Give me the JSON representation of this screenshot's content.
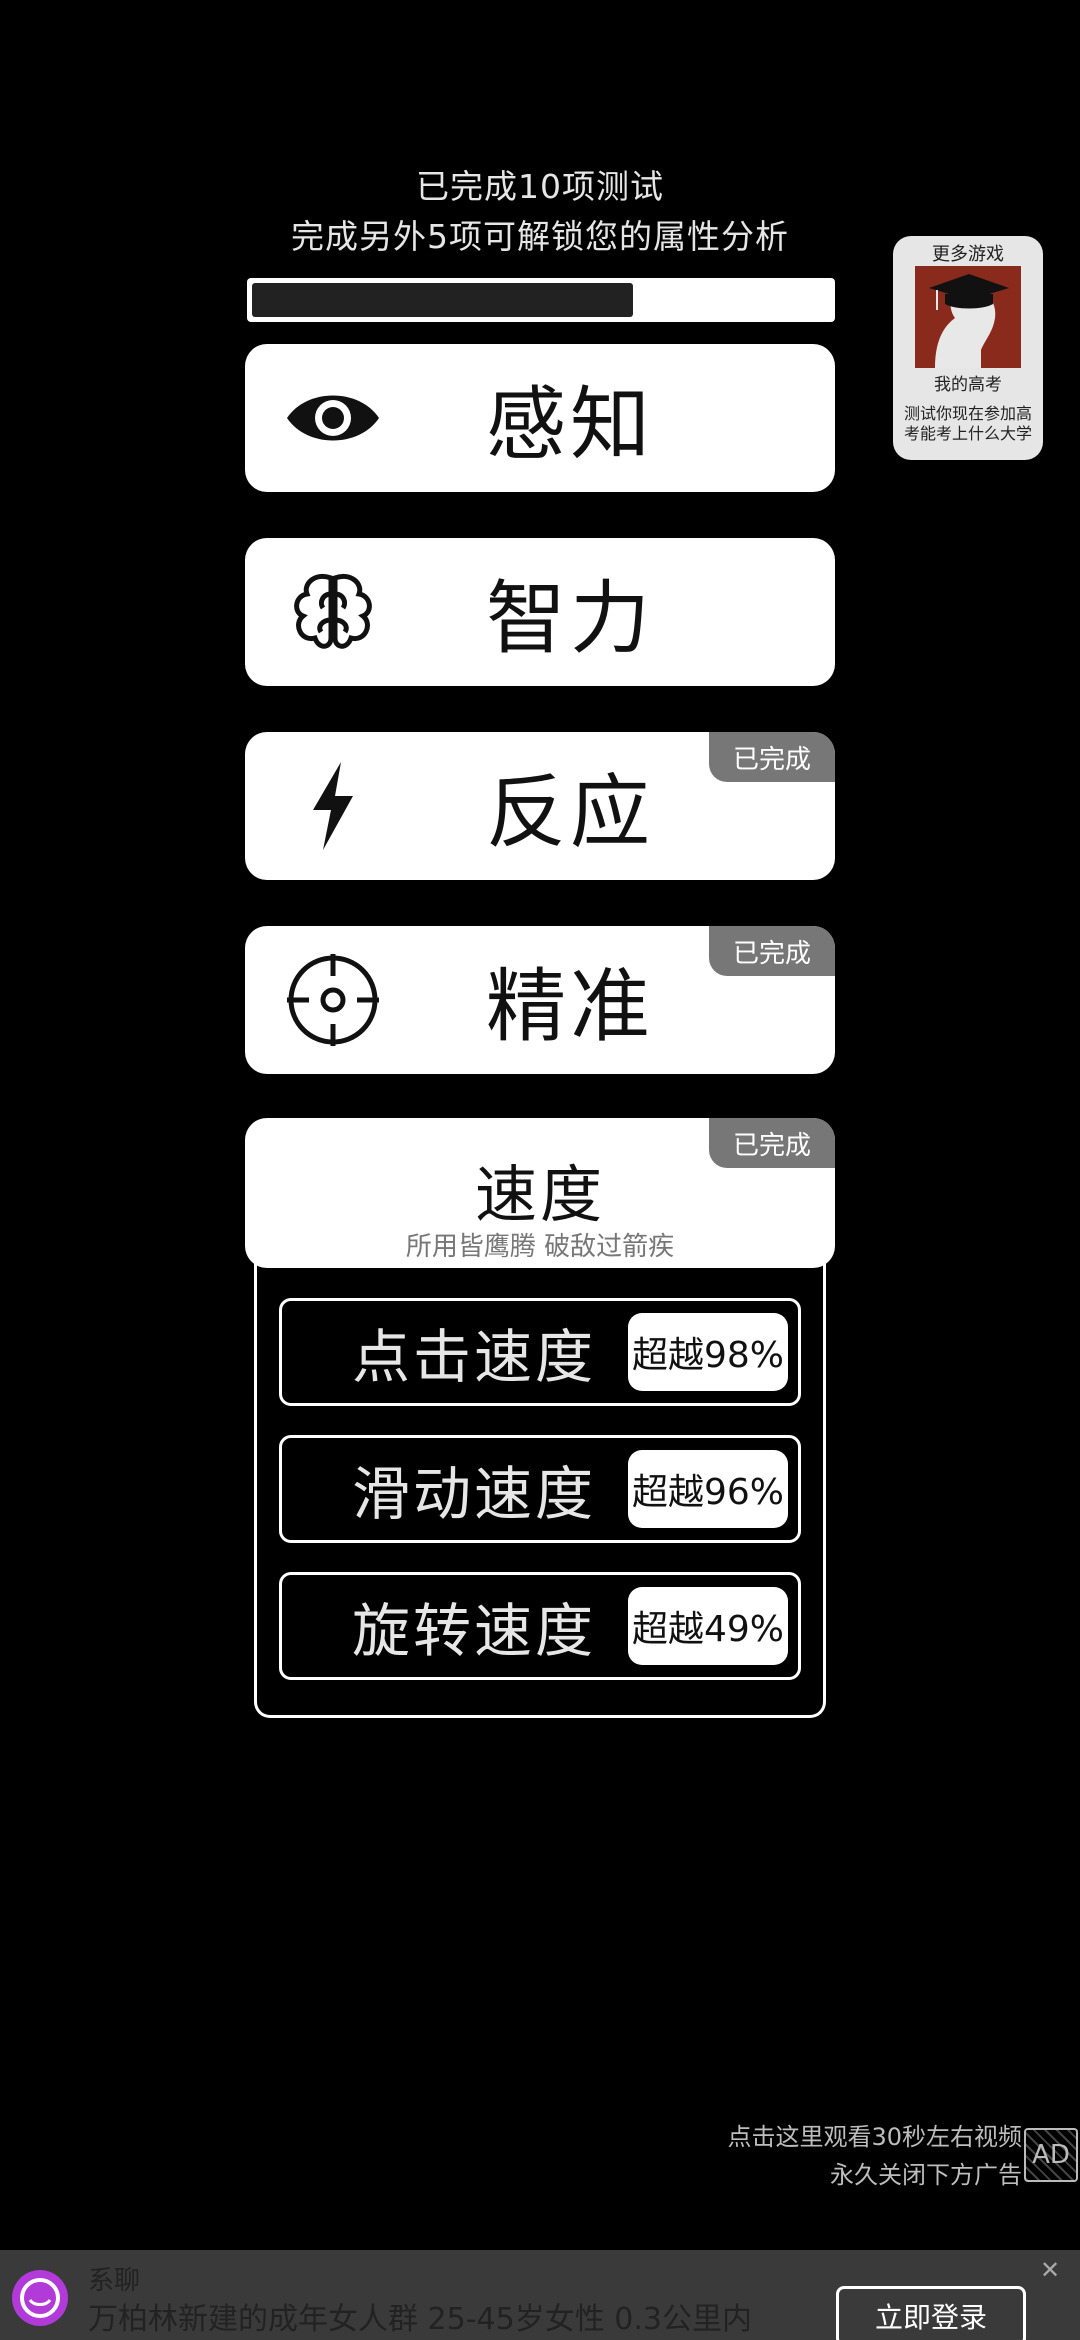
{
  "header": {
    "line1": "已完成10项测试",
    "line2": "完成另外5项可解锁您的属性分析"
  },
  "progress": {
    "fraction": 0.66
  },
  "categories": [
    {
      "label": "感知",
      "icon": "eye-icon",
      "completed": false
    },
    {
      "label": "智力",
      "icon": "brain-icon",
      "completed": false
    },
    {
      "label": "反应",
      "icon": "lightning-icon",
      "completed": true,
      "badge": "已完成"
    },
    {
      "label": "精准",
      "icon": "crosshair-icon",
      "completed": true,
      "badge": "已完成"
    }
  ],
  "speed": {
    "title": "速度",
    "subtitle": "所用皆鹰腾 破敌过箭疾",
    "badge": "已完成",
    "items": [
      {
        "label": "点击速度",
        "value": "超越98%"
      },
      {
        "label": "滑动速度",
        "value": "超越96%"
      },
      {
        "label": "旋转速度",
        "value": "超越49%"
      }
    ]
  },
  "more_games": {
    "title": "更多游戏",
    "name": "我的高考",
    "desc": "测试你现在参加高考能考上什么大学",
    "icon": "graduation-cap-icon"
  },
  "ad_notice": {
    "line1": "点击这里观看30秒左右视频",
    "line2": "永久关闭下方广告",
    "mark": "AD"
  },
  "ad_banner": {
    "brand": "系聊",
    "text": "万柏林新建的成年女人群 25-45岁女性 0.3公里内",
    "button": "立即登录",
    "close": "✕"
  }
}
